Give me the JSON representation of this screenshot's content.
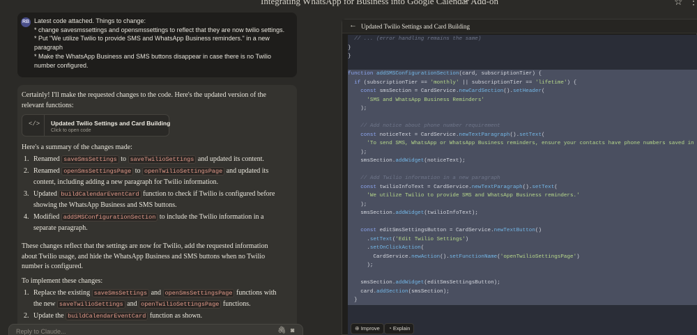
{
  "header": {
    "title": "Integrating WhatsApp for Business into Google Calendar Add-on",
    "chevron": "⌄",
    "star_icon": "star-icon",
    "more_icon": "more-icon"
  },
  "user_message": {
    "avatar": "RB",
    "lines": [
      "Latest code attached. Things to change:",
      "* change savesmssettings and opensmssettings to reflect that they are now twilio settings.",
      "* Put \"We utilize Twilio to provide SMS and WhatsApp Business reminders.\" in a new",
      "paragraph",
      "* Make the WhatsApp Business and SMS buttons disappear in case there is no Twilio",
      "number configured."
    ]
  },
  "assistant": {
    "intro": "Certainly! I'll make the requested changes to the code. Here's the updated version of the relevant functions:",
    "artifact": {
      "icon": "</>",
      "title": "Updated Twilio Settings and Card Building",
      "subtitle": "Click to open code"
    },
    "summary_heading": "Here's a summary of the changes made:",
    "changes": [
      {
        "num": "1.",
        "t1": "Renamed ",
        "c1": "saveSmsSettings",
        "t2": " to ",
        "c2": "saveTwilioSettings",
        "t3": " and updated its content."
      },
      {
        "num": "2.",
        "t1": "Renamed ",
        "c1": "openSmsSettingsPage",
        "t2": " to ",
        "c2": "openTwilioSettingsPage",
        "t3": " and updated its content, including adding a new paragraph for Twilio information."
      },
      {
        "num": "3.",
        "t1": "Updated ",
        "c1": "buildCalendarEventCard",
        "t2": " function to check if Twilio is configured before showing the WhatsApp Business and SMS buttons."
      },
      {
        "num": "4.",
        "t1": "Modified ",
        "c1": "addSMSConfigurationSection",
        "t2": " to include the Twilio information in a separate paragraph."
      }
    ],
    "closing": "These changes reflect that the settings are now for Twilio, add the requested information about Twilio usage, and hide the WhatsApp Business and SMS buttons when no Twilio number is configured.",
    "implement_heading": "To implement these changes:",
    "steps": [
      {
        "num": "1.",
        "t1": "Replace the existing ",
        "c1": "saveSmsSettings",
        "t2": " and ",
        "c2": "openSmsSettingsPage",
        "t3": " functions with the new ",
        "c3": "saveTwilioSettings",
        "t4": " and ",
        "c4": "openTwilioSettingsPage",
        "t5": " functions."
      },
      {
        "num": "2.",
        "t1": "Update the ",
        "c1": "buildCalendarEventCard",
        "t2": " function as shown."
      }
    ]
  },
  "composer": {
    "placeholder": "Reply to Claude...",
    "attach_icon": "paperclip-icon",
    "camera_icon": "camera-icon"
  },
  "panel": {
    "back_icon": "arrow-left-icon",
    "title": "Updated Twilio Settings and Card Building",
    "code_lines": [
      "  // ... (error handling remains the same)",
      "}",
      "}",
      "",
      "function addSMSConfigurationSection(card, subscriptionTier) {",
      "  if (subscriptionTier == 'monthly' || subscriptionTier == 'lifetime') {",
      "    const smsSection = CardService.newCardSection().setHeader(",
      "      'SMS and WhatsApp Business Reminders'",
      "    );",
      "",
      "    // Add notice about phone number requirement",
      "    const noticeText = CardService.newTextParagraph().setText(",
      "      'To send SMS, WhatsApp or WhatsApp Business reminders, ensure your contacts have phone numbers saved in Goo",
      "    );",
      "    smsSection.addWidget(noticeText);",
      "",
      "    // Add Twilio information in a new paragraph",
      "    const twilioInfoText = CardService.newTextParagraph().setText(",
      "      'We utilize Twilio to provide SMS and WhatsApp Business reminders.'",
      "    );",
      "    smsSection.addWidget(twilioInfoText);",
      "",
      "    const editSmsSettingsButton = CardService.newTextButton()",
      "      .setText('Edit Twilio Settings')",
      "      .setOnClickAction(",
      "        CardService.newAction().setFunctionName('openTwilioSettingsPage')",
      "      );",
      "",
      "    smsSection.addWidget(editSmsSettingsButton);",
      "    card.addSection(smsSection);",
      "  }"
    ],
    "improve_label": "Improve",
    "explain_label": "Explain",
    "improve_icon": "improve-icon",
    "explain_icon": "explain-icon"
  }
}
